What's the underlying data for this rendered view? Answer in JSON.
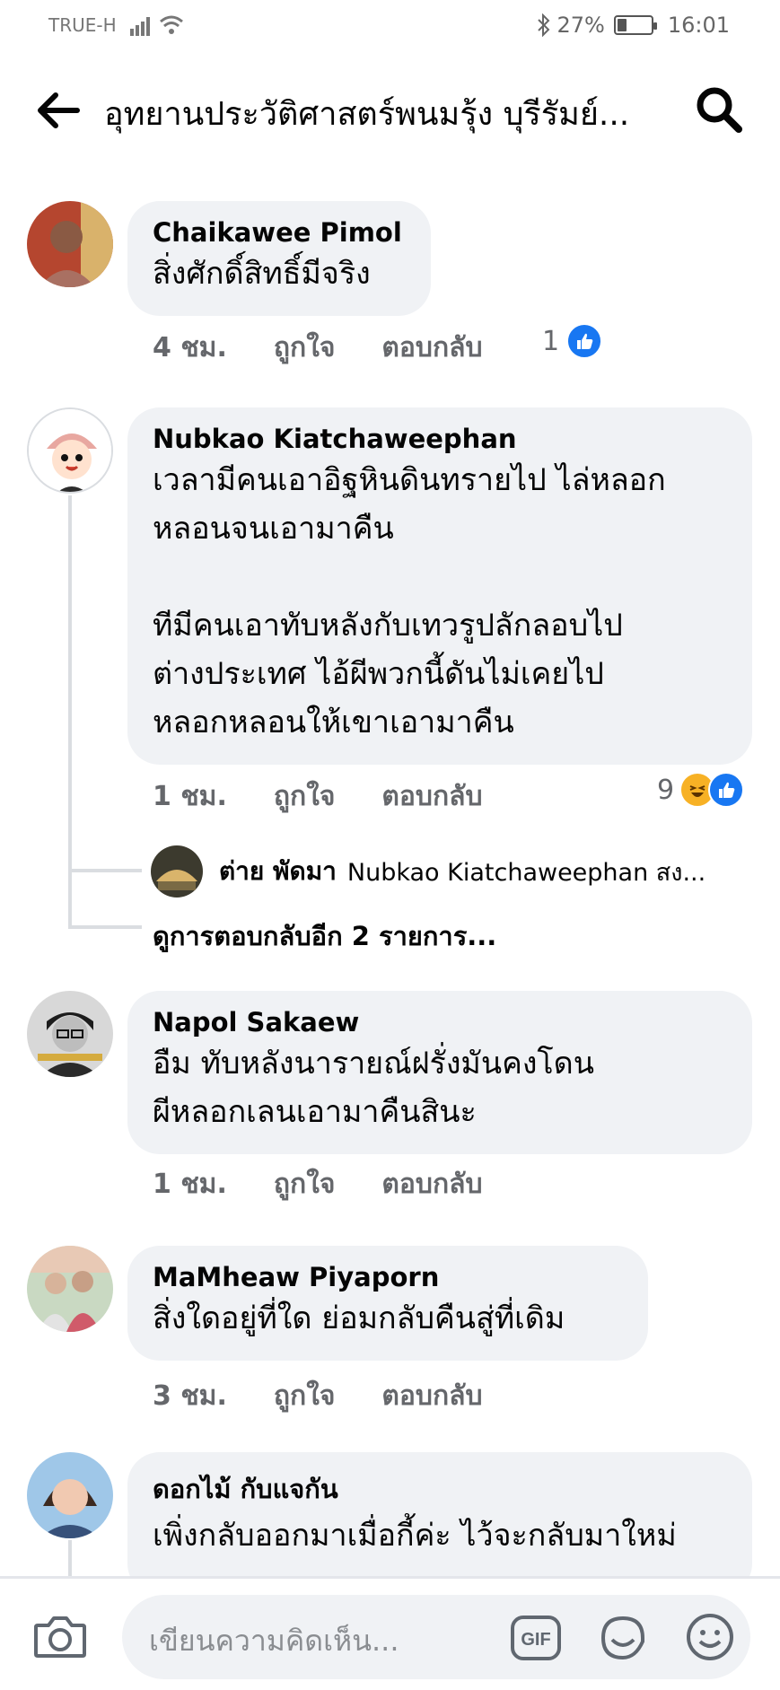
{
  "status_bar": {
    "carrier": "TRUE-H",
    "battery_percent": "27%",
    "battery_level": 0.27,
    "time": "16:01"
  },
  "header": {
    "title": "อุทยานประวัติศาสตร์พนมรุ้ง บุรีรัมย์...",
    "back_icon": "arrow-left-icon",
    "search_icon": "search-icon"
  },
  "comments": [
    {
      "name": "Chaikawee Pimol",
      "text": "สิ่งศักดิ์สิทธิ์มีจริง",
      "time": "4 ชม.",
      "like_label": "ถูกใจ",
      "reply_label": "ตอบกลับ",
      "reaction_count": "1",
      "reactions": [
        "like"
      ]
    },
    {
      "name": "Nubkao Kiatchaweephan",
      "text": "เวลามีคนเอาอิฐหินดินทรายไป ไล่หลอก\nหลอนจนเอามาคืน\n\nทีมีคนเอาทับหลังกับเทวรูปลักลอบไป\nต่างประเทศ ไอ้ผีพวกนี้ดันไม่เคยไป\nหลอกหลอนให้เขาเอามาคืน",
      "time": "1 ชม.",
      "like_label": "ถูกใจ",
      "reply_label": "ตอบกลับ",
      "reaction_count": "9",
      "reactions": [
        "haha",
        "like"
      ],
      "reply_preview": {
        "name": "ต่าย พัดมา",
        "text": "Nubkao Kiatchaweephan สง..."
      },
      "more_replies": "ดูการตอบกลับอีก 2 รายการ..."
    },
    {
      "name": "Napol Sakaew",
      "text": "อืม ทับหลังนารายณ์ฝรั่งมันคงโดน\nผีหลอกเลนเอามาคืนสินะ",
      "time": "1 ชม.",
      "like_label": "ถูกใจ",
      "reply_label": "ตอบกลับ"
    },
    {
      "name": "MaMheaw Piyaporn",
      "text": "สิ่งใดอยู่ที่ใด ย่อมกลับคืนสู่ที่เดิม",
      "time": "3 ชม.",
      "like_label": "ถูกใจ",
      "reply_label": "ตอบกลับ"
    },
    {
      "name": "ดอกไม้ กับแจกัน",
      "text": "เพิ่งกลับออกมาเมื่อกี้ค่ะ ไว้จะกลับมาใหม่"
    }
  ],
  "composer": {
    "placeholder": "เขียนความคิดเห็น...",
    "gif_label": "GIF",
    "camera_icon": "camera-icon",
    "sticker_icon": "sticker-icon",
    "emoji_icon": "emoji-icon"
  },
  "colors": {
    "bubble": "#f0f2f5",
    "meta_text": "#65676b",
    "like_blue": "#1877f2",
    "haha_yellow": "#f7b125"
  }
}
